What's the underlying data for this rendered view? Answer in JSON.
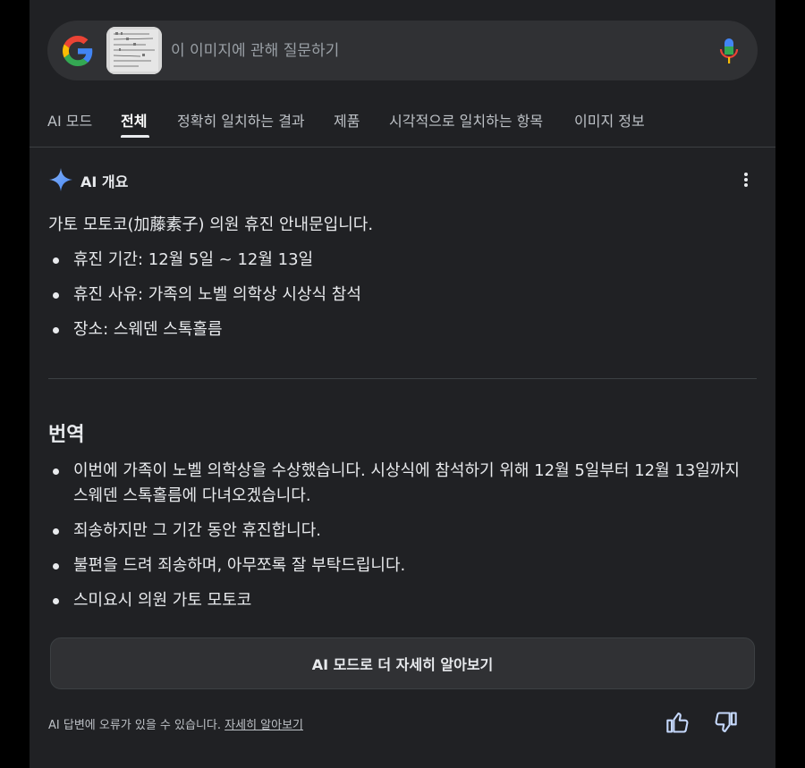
{
  "search": {
    "placeholder": "이 이미지에 관해 질문하기"
  },
  "tabs": [
    {
      "label": "AI 모드"
    },
    {
      "label": "전체"
    },
    {
      "label": "정확히 일치하는 결과"
    },
    {
      "label": "제품"
    },
    {
      "label": "시각적으로 일치하는 항목"
    },
    {
      "label": "이미지 정보"
    }
  ],
  "active_tab": "전체",
  "overview": {
    "title": "AI 개요",
    "summary": "가토 모토코(加藤素子) 의원 휴진 안내문입니다.",
    "details": [
      "휴진 기간: 12월 5일 ~ 12월 13일",
      "휴진 사유: 가족의 노벨 의학상 시상식 참석",
      "장소: 스웨덴 스톡홀름"
    ],
    "translation_heading": "번역",
    "translation": [
      "이번에 가족이 노벨 의학상을 수상했습니다. 시상식에 참석하기 위해 12월 5일부터 12월 13일까지 스웨덴 스톡홀름에 다녀오겠습니다.",
      "죄송하지만 그 기간 동안 휴진합니다.",
      "불편을 드려 죄송하며, 아무쪼록 잘 부탁드립니다.",
      "스미요시 의원 가토 모토코"
    ],
    "more_button": "AI 모드로 더 자세히 알아보기",
    "footer_text": "AI 답변에 오류가 있을 수 있습니다.",
    "footer_link": "자세히 알아보기"
  },
  "icons": {
    "logo": "google-g-icon",
    "mic": "microphone-icon",
    "sparkle": "ai-sparkle-icon",
    "menu": "more-vert-icon",
    "thumbs_up": "thumbs-up-icon",
    "thumbs_down": "thumbs-down-icon"
  },
  "colors": {
    "background": "#202124",
    "surface": "#303134",
    "text": "#e8eaed",
    "muted": "#bdc1c6",
    "accent_blue": "#8ab4f8"
  }
}
